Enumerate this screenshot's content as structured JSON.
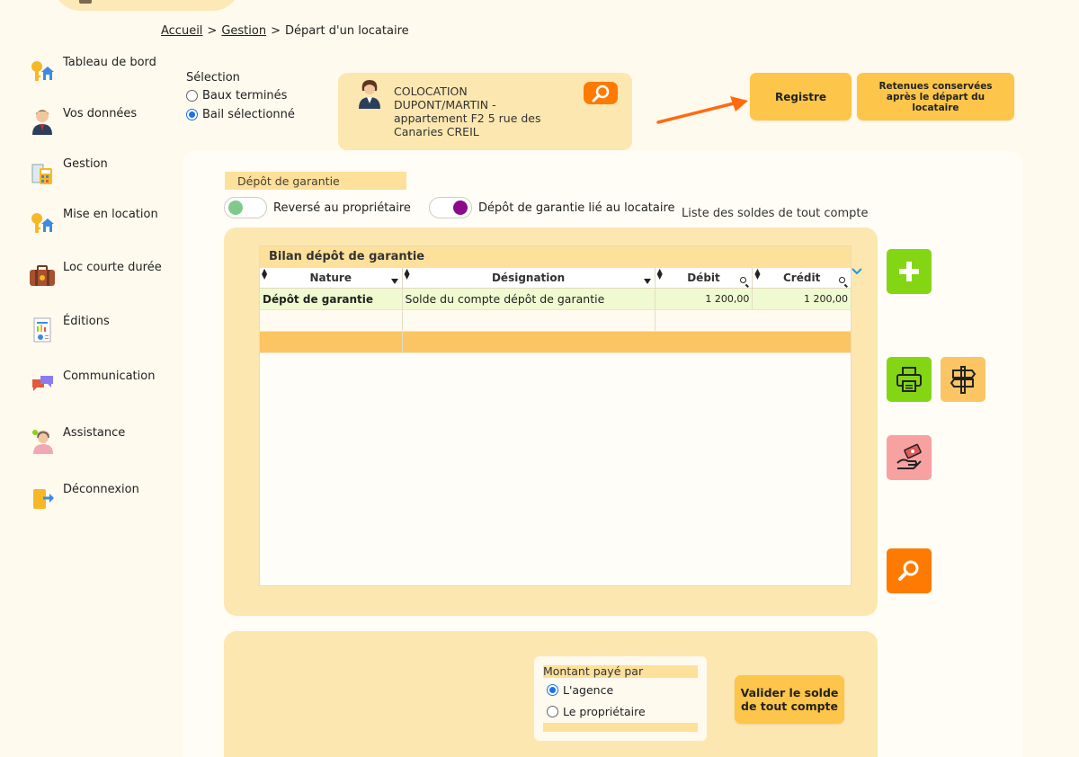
{
  "breadcrumb": {
    "home": "Accueil",
    "sep1": ">",
    "section": "Gestion",
    "sep2": ">",
    "current": "Départ d'un locataire"
  },
  "sidebar": {
    "items": [
      {
        "label": "Tableau de bord",
        "icon": "house-key-icon"
      },
      {
        "label": "Vos données",
        "icon": "user-icon"
      },
      {
        "label": "Gestion",
        "icon": "calculator-icon"
      },
      {
        "label": "Mise en location",
        "icon": "house-key-icon"
      },
      {
        "label": "Loc courte durée",
        "icon": "suitcase-icon"
      },
      {
        "label": "Éditions",
        "icon": "report-icon"
      },
      {
        "label": "Communication",
        "icon": "chat-bubbles-icon"
      },
      {
        "label": "Assistance",
        "icon": "support-agent-icon"
      },
      {
        "label": "Déconnexion",
        "icon": "logout-icon"
      }
    ]
  },
  "selection": {
    "title": "Sélection",
    "option1": "Baux terminés",
    "option2": "Bail sélectionné",
    "selected": "Bail sélectionné"
  },
  "tenant": {
    "line1": "COLOCATION",
    "line2": "DUPONT/MARTIN -",
    "line3": "appartement F2 5 rue des",
    "line4": "Canaries CREIL"
  },
  "buttons": {
    "registre": "Registre",
    "retenues": "Retenues conservées après le départ du locataire",
    "valider": "Valider le solde de tout compte"
  },
  "depot": {
    "tab": "Dépôt de garantie",
    "toggle1": "Reversé au propriétaire",
    "toggle2": "Dépôt de garantie lié au locataire",
    "liste": "Liste des soldes de tout compte"
  },
  "grid": {
    "title": "Bilan dépôt de garantie",
    "columns": {
      "nature": "Nature",
      "designation": "Désignation",
      "debit": "Débit",
      "credit": "Crédit"
    },
    "rows": [
      {
        "nature": "Dépôt de garantie",
        "designation": "Solde du compte dépôt de garantie",
        "debit": "1 200,00",
        "credit": "1 200,00"
      }
    ]
  },
  "paid": {
    "title": "Montant payé par",
    "option1": "L'agence",
    "option2": "Le propriétaire",
    "selected": "L'agence"
  },
  "colors": {
    "accent_orange": "#ff7a00",
    "button_yellow": "#fdc549",
    "panel": "#fde7b0",
    "green": "#84d614",
    "pink": "#f8a1a1"
  }
}
